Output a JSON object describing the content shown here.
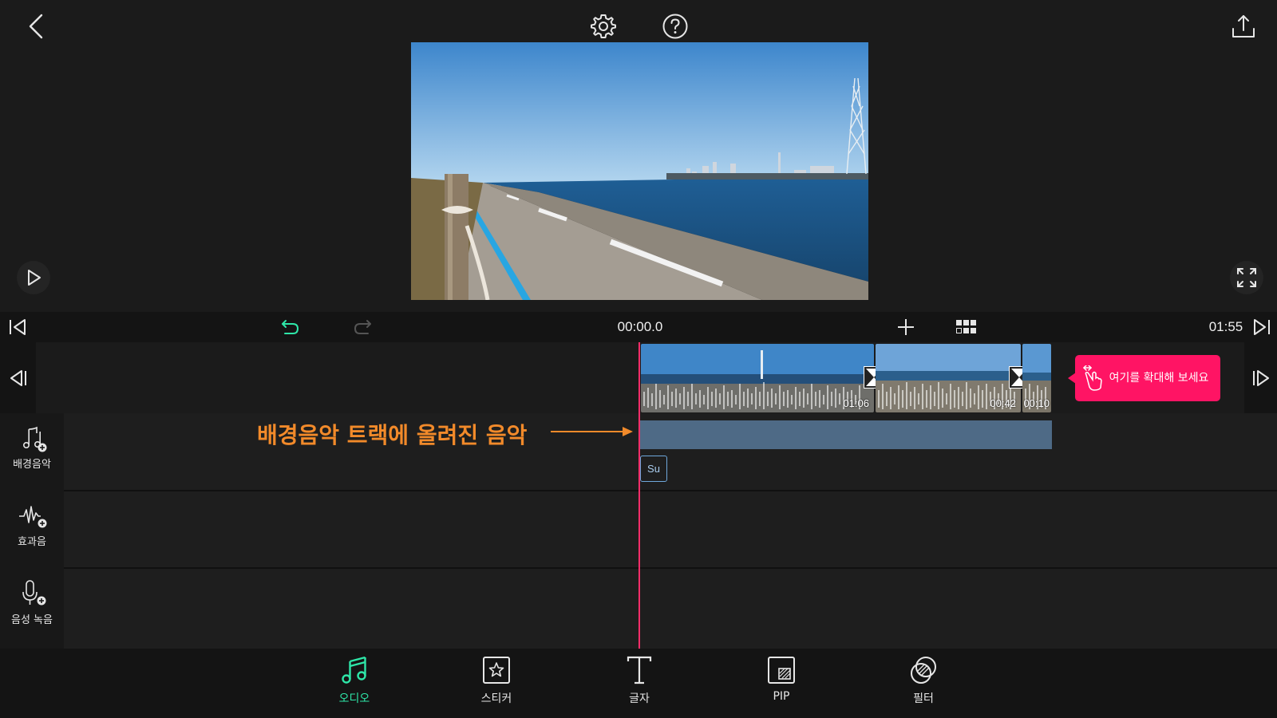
{
  "colors": {
    "accent": "#2ee6a8",
    "playhead": "#ff2d6a",
    "tooltip_bg": "#ff1464",
    "annotation": "#f28a2a",
    "bgm_clip": "#4e6a86"
  },
  "header": {
    "icons": [
      "back-icon",
      "settings-gear-icon",
      "help-icon",
      "export-share-icon"
    ]
  },
  "preview": {
    "play_icon": "play-icon",
    "fullscreen_icon": "fullscreen-icon"
  },
  "toolbar": {
    "current_time": "00:00.0",
    "total_time": "01:55",
    "icons": [
      "jump-to-start-icon",
      "undo-icon",
      "redo-icon",
      "add-icon",
      "grid-view-icon",
      "jump-to-end-icon"
    ]
  },
  "video_track": {
    "clips": [
      {
        "duration": "01:06"
      },
      {
        "duration": "00:42"
      },
      {
        "duration": "00:10"
      }
    ]
  },
  "tooltip": {
    "text": "여기를 확대해 보세요",
    "icon": "pinch-zoom-icon"
  },
  "annotation": {
    "text": "배경음악 트랙에 올려진 음악"
  },
  "bgm_track": {
    "tag": "Su"
  },
  "audio_tools": [
    {
      "label": "배경음악",
      "icon": "music-add-icon"
    },
    {
      "label": "효과음",
      "icon": "sound-effect-add-icon"
    },
    {
      "label": "음성 녹음",
      "icon": "mic-add-icon"
    }
  ],
  "bottom_tabs": [
    {
      "label": "오디오",
      "icon": "music-note-icon",
      "active": true
    },
    {
      "label": "스티커",
      "icon": "sticker-icon",
      "active": false
    },
    {
      "label": "글자",
      "icon": "text-icon",
      "active": false
    },
    {
      "label": "PIP",
      "icon": "pip-icon",
      "active": false
    },
    {
      "label": "필터",
      "icon": "filter-icon",
      "active": false
    }
  ]
}
